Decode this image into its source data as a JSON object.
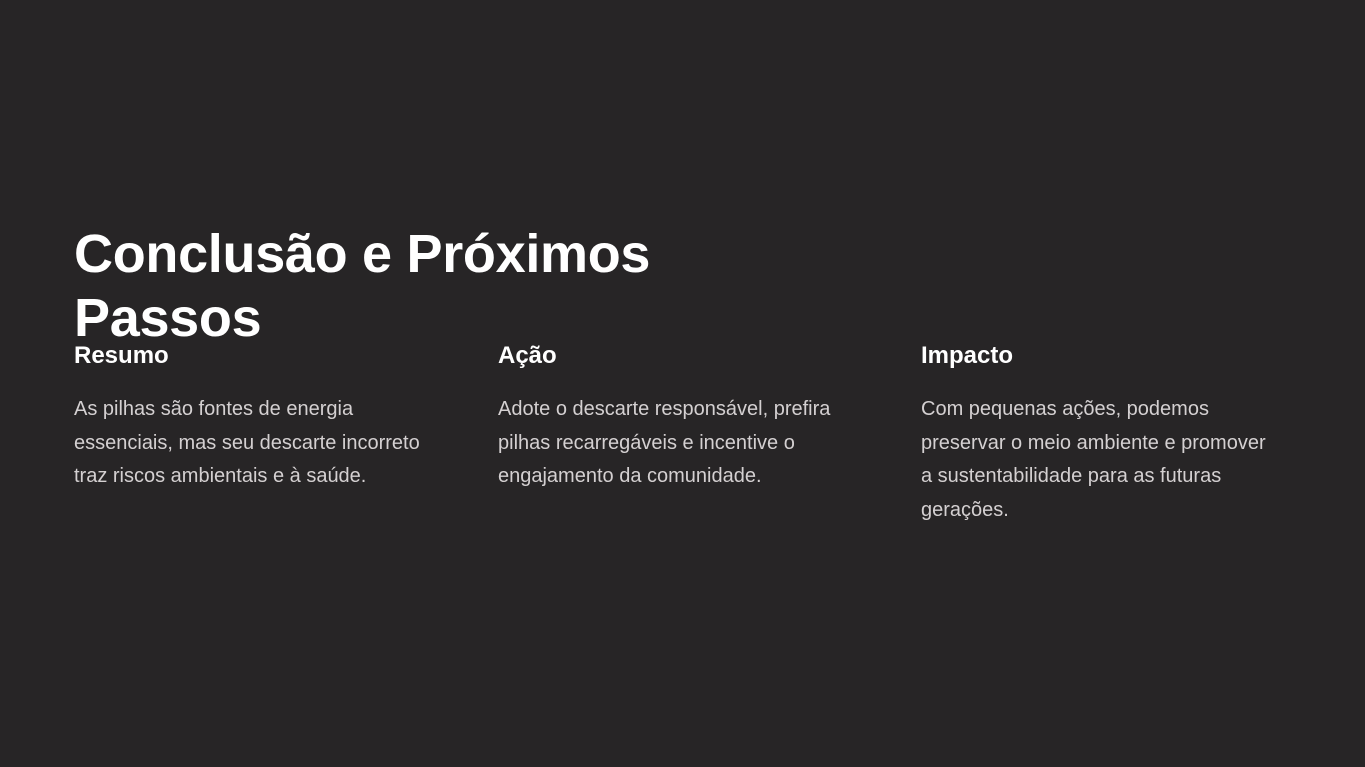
{
  "slide": {
    "title": "Conclusão e Próximos Passos",
    "columns": [
      {
        "heading": "Resumo",
        "text": "As pilhas são fontes de energia essenciais, mas seu descarte incorreto traz riscos ambientais e à saúde."
      },
      {
        "heading": "Ação",
        "text": "Adote o descarte responsável, prefira pilhas recarregáveis e incentive o engajamento da comunidade."
      },
      {
        "heading": "Impacto",
        "text": "Com pequenas ações, podemos preservar o meio ambiente e promover a sustentabilidade para as futuras gerações."
      }
    ]
  },
  "colors": {
    "background": "#272526",
    "heading": "#ffffff",
    "body_text": "#d4d0d1"
  }
}
